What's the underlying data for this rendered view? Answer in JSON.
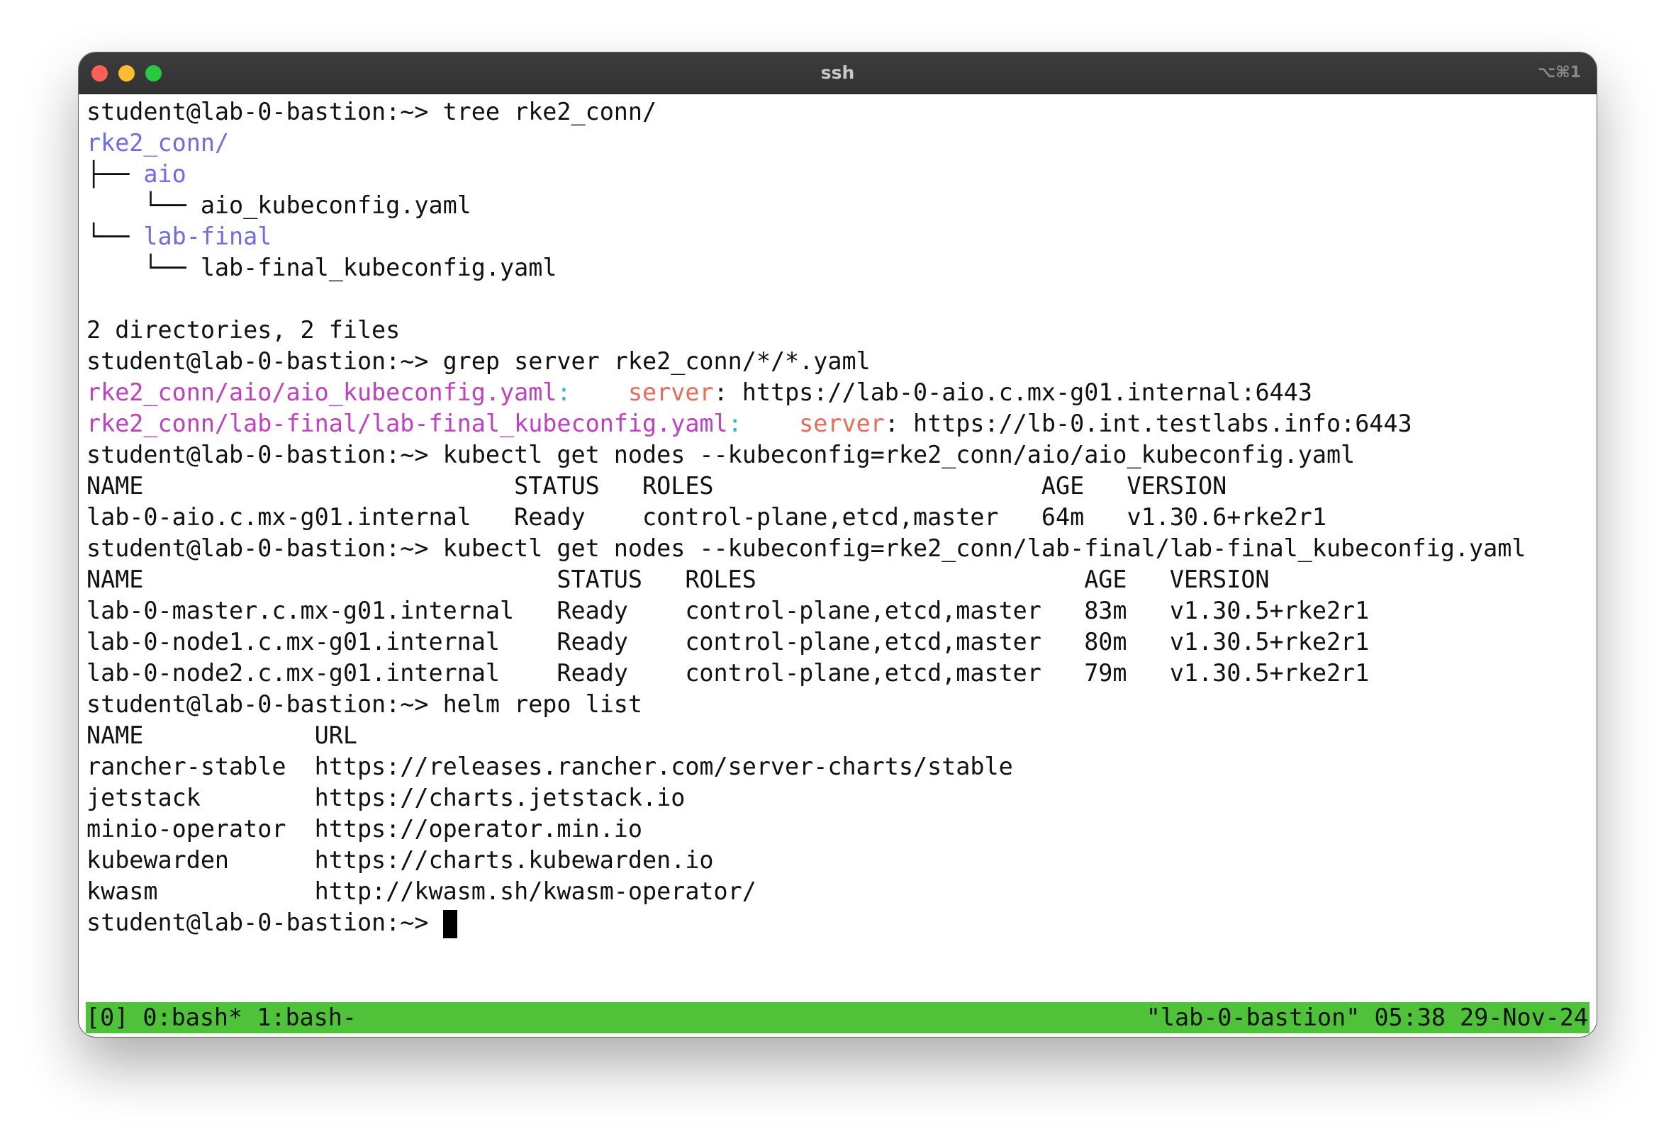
{
  "window": {
    "title": "ssh",
    "shortcut": "⌥⌘1"
  },
  "prompt": "student@lab-0-bastion:~> ",
  "commands": {
    "tree": "tree rke2_conn/",
    "grep": "grep server rke2_conn/*/*.yaml",
    "kubectl_aio": "kubectl get nodes --kubeconfig=rke2_conn/aio/aio_kubeconfig.yaml",
    "kubectl_final": "kubectl get nodes --kubeconfig=rke2_conn/lab-final/lab-final_kubeconfig.yaml",
    "helm": "helm repo list"
  },
  "tree": {
    "root": "rke2_conn/",
    "branch1_prefix": "├── ",
    "dir1": "aio",
    "leaf1_prefix": "    └── ",
    "file1": "aio_kubeconfig.yaml",
    "branch2_prefix": "└── ",
    "dir2": "lab-final",
    "leaf2_prefix": "    └── ",
    "file2": "lab-final_kubeconfig.yaml",
    "summary": "2 directories, 2 files"
  },
  "grep": {
    "r1_file": "rke2_conn/aio/aio_kubeconfig.yaml",
    "r1_gap": "    ",
    "r1_url": ": https://lab-0-aio.c.mx-g01.internal:6443",
    "r2_file": "rke2_conn/lab-final/lab-final_kubeconfig.yaml",
    "r2_gap": "    ",
    "r2_url": ": https://lb-0.int.testlabs.info:6443",
    "sep": ":",
    "keyword": "server"
  },
  "aio_nodes": {
    "header": "NAME                          STATUS   ROLES                       AGE   VERSION",
    "row1": "lab-0-aio.c.mx-g01.internal   Ready    control-plane,etcd,master   64m   v1.30.6+rke2r1"
  },
  "final_nodes": {
    "header": "NAME                             STATUS   ROLES                       AGE   VERSION",
    "row1": "lab-0-master.c.mx-g01.internal   Ready    control-plane,etcd,master   83m   v1.30.5+rke2r1",
    "row2": "lab-0-node1.c.mx-g01.internal    Ready    control-plane,etcd,master   80m   v1.30.5+rke2r1",
    "row3": "lab-0-node2.c.mx-g01.internal    Ready    control-plane,etcd,master   79m   v1.30.5+rke2r1"
  },
  "helm": {
    "header": "NAME            URL",
    "row1": "rancher-stable  https://releases.rancher.com/server-charts/stable",
    "row2": "jetstack        https://charts.jetstack.io",
    "row3": "minio-operator  https://operator.min.io",
    "row4": "kubewarden      https://charts.kubewarden.io",
    "row5": "kwasm           http://kwasm.sh/kwasm-operator/"
  },
  "statusbar": {
    "left": "[0] 0:bash* 1:bash-",
    "right": "\"lab-0-bastion\" 05:38 29-Nov-24",
    "color": "#4ec33a"
  }
}
